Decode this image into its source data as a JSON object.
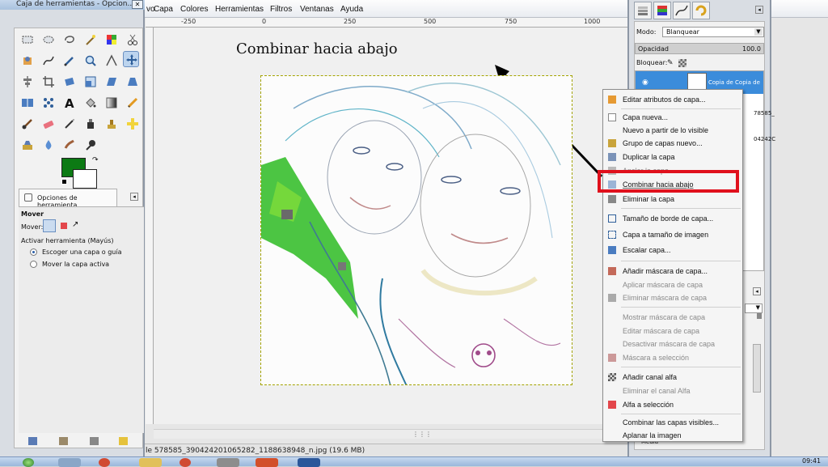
{
  "menubar": {
    "left_fragment": "vo",
    "items": [
      "Capa",
      "Colores",
      "Herramientas",
      "Filtros",
      "Ventanas",
      "Ayuda"
    ]
  },
  "ruler": {
    "ticks": [
      "-250",
      "0",
      "250",
      "500",
      "750",
      "1000"
    ]
  },
  "slide": {
    "title": "Combinar hacia abajo"
  },
  "status": {
    "file": "le 578585_390424201065282_1188638948_n.jpg (19.6 MB)"
  },
  "toolbox": {
    "title": "Caja de herramientas - Opcion...",
    "close_glyph": "✕",
    "tab_label": "Opciones de herramienta",
    "tool_name": "Mover",
    "mover_label": "Mover:",
    "activate_label": "Activar herramienta  (Mayús)",
    "option_pick": "Escoger una capa o guía",
    "option_move_active": "Mover la capa activa",
    "fg_color": "#0c7a14"
  },
  "layers": {
    "mode_label": "Modo:",
    "mode_value": "Blanquear",
    "opacity_label": "Opacidad",
    "opacity_value": "100.0",
    "lock_label": "Bloquear:",
    "selected_layer": "Copia de Copia de",
    "fragment_1": "78585_",
    "fragment_2": "04242C",
    "media_label": "Media"
  },
  "context_menu": {
    "items": [
      {
        "label": "Editar atributos de capa...",
        "disabled": false
      },
      {
        "label": "Capa nueva...",
        "disabled": false
      },
      {
        "label": "Nuevo a partir de lo visible",
        "disabled": false
      },
      {
        "label": "Grupo de capas nuevo...",
        "disabled": false
      },
      {
        "label": "Duplicar la capa",
        "disabled": false
      },
      {
        "label": "Anclar la capa",
        "disabled": true
      },
      {
        "label": "Combinar hacia abajo",
        "disabled": false
      },
      {
        "label": "Eliminar la capa",
        "disabled": false
      },
      {
        "label": "Tamaño de borde de capa...",
        "disabled": false
      },
      {
        "label": "Capa a tamaño de imagen",
        "disabled": false
      },
      {
        "label": "Escalar capa...",
        "disabled": false
      },
      {
        "label": "Añadir máscara de capa...",
        "disabled": false
      },
      {
        "label": "Aplicar máscara de capa",
        "disabled": true
      },
      {
        "label": "Eliminar máscara de capa",
        "disabled": true
      },
      {
        "label": "Mostrar máscara de capa",
        "disabled": true
      },
      {
        "label": "Editar máscara de capa",
        "disabled": true
      },
      {
        "label": "Desactivar máscara de capa",
        "disabled": true
      },
      {
        "label": "Máscara a selección",
        "disabled": true
      },
      {
        "label": "Añadir canal alfa",
        "disabled": false
      },
      {
        "label": "Eliminar el canal Alfa",
        "disabled": true
      },
      {
        "label": "Alfa a selección",
        "disabled": false
      },
      {
        "label": "Combinar las capas visibles...",
        "disabled": false
      },
      {
        "label": "Aplanar la imagen",
        "disabled": false
      }
    ]
  },
  "taskbar": {
    "clock": "09:41"
  }
}
